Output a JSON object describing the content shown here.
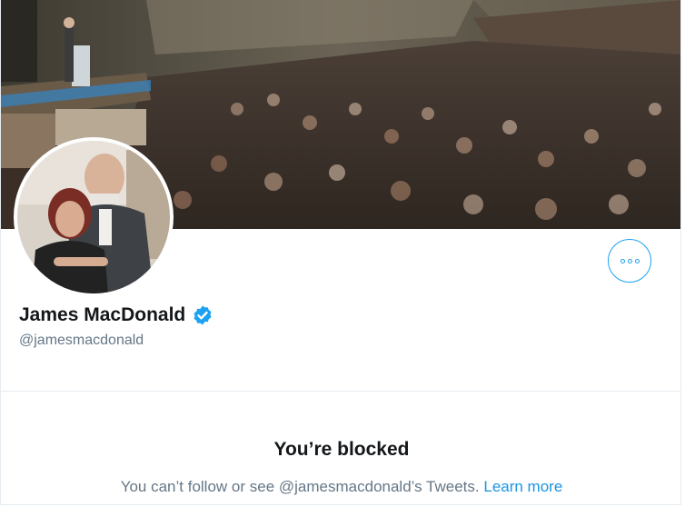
{
  "profile": {
    "display_name": "James MacDonald",
    "handle": "@jamesmacdonald",
    "verified": true
  },
  "icons": {
    "banner": "auditorium-crowd-photo",
    "avatar": "profile-photo-couple",
    "verified": "verified-badge-icon",
    "more": "more-options-icon"
  },
  "blocked": {
    "title": "You’re blocked",
    "message": "You can’t follow or see @jamesmacdonald’s Tweets.",
    "link_label": "Learn more"
  },
  "colors": {
    "accent": "#1da1f2",
    "link": "#1b95e0",
    "text_primary": "#14171a",
    "text_secondary": "#657786",
    "divider": "#e6ecf0"
  }
}
